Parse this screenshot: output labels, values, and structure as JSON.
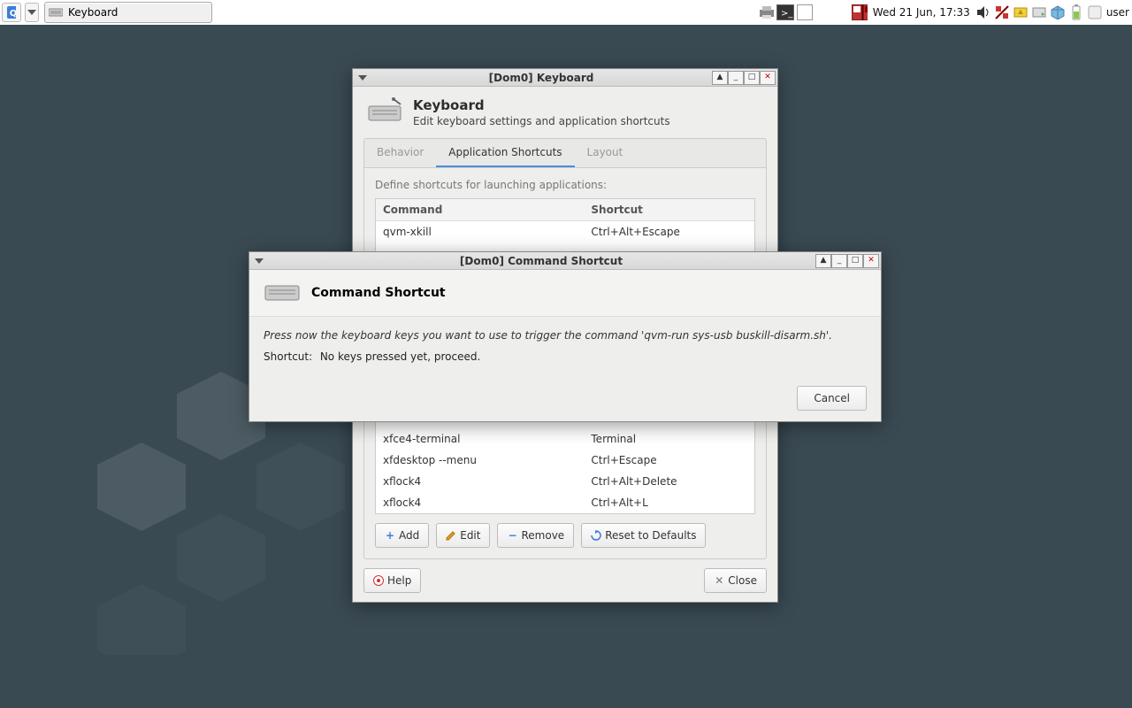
{
  "panel": {
    "task_title": "Keyboard",
    "clock": "Wed 21 Jun, 17:33",
    "user": "user"
  },
  "kbd_window": {
    "title": "[Dom0] Keyboard",
    "heading": "Keyboard",
    "sub": "Edit keyboard settings and application shortcuts",
    "tabs": {
      "behavior": "Behavior",
      "shortcuts": "Application Shortcuts",
      "layout": "Layout"
    },
    "define_label": "Define shortcuts for launching applications:",
    "columns": {
      "command": "Command",
      "shortcut": "Shortcut"
    },
    "rows_top": [
      {
        "cmd": "qvm-xkill",
        "sc": "Ctrl+Alt+Escape"
      }
    ],
    "rows_bottom": [
      {
        "cmd": "xfce4-terminal",
        "sc": "Terminal"
      },
      {
        "cmd": "xfdesktop --menu",
        "sc": "Ctrl+Escape"
      },
      {
        "cmd": "xflock4",
        "sc": "Ctrl+Alt+Delete"
      },
      {
        "cmd": "xflock4",
        "sc": "Ctrl+Alt+L"
      }
    ],
    "buttons": {
      "add": "Add",
      "edit": "Edit",
      "remove": "Remove",
      "reset": "Reset to Defaults",
      "help": "Help",
      "close": "Close"
    }
  },
  "dialog": {
    "title": "[Dom0] Command Shortcut",
    "heading": "Command Shortcut",
    "instruction": "Press now the keyboard keys you want to use to trigger the command 'qvm-run sys-usb buskill-disarm.sh'.",
    "shortcut_label": "Shortcut:",
    "shortcut_value": "No keys pressed yet, proceed.",
    "cancel": "Cancel"
  }
}
